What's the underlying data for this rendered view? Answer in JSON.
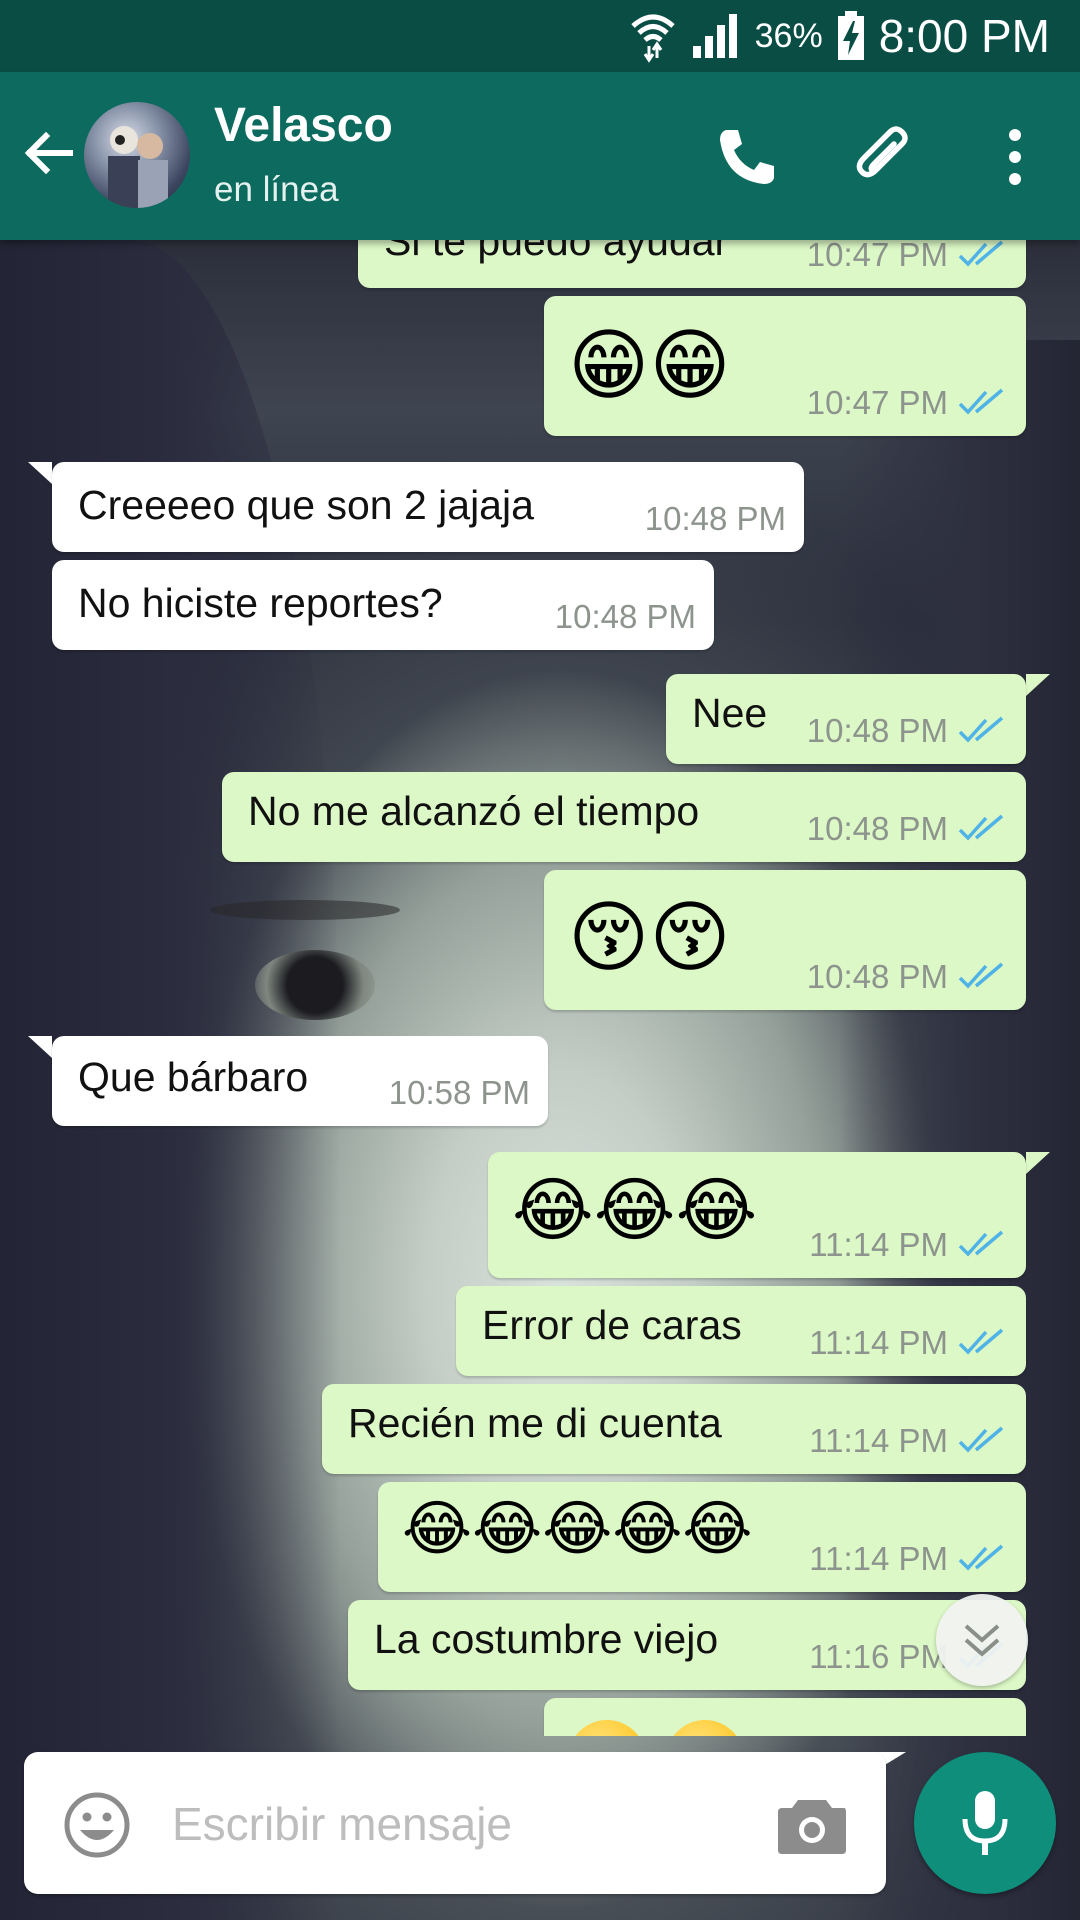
{
  "status_bar": {
    "battery_percent": "36%",
    "time": "8:00 PM",
    "icons": [
      "wifi-icon",
      "signal-icon",
      "battery-charging-icon"
    ]
  },
  "header": {
    "contact_name": "Velasco",
    "contact_status": "en línea",
    "icons": [
      "back-arrow-icon",
      "phone-icon",
      "paperclip-icon",
      "more-vert-icon"
    ],
    "colors": {
      "status_bar": "#094d44",
      "app_bar": "#0c6b5e"
    }
  },
  "messages": [
    {
      "dir": "out",
      "text": "Si te puedo ayudar",
      "time": "10:47 PM"
    },
    {
      "dir": "out",
      "emoji": "😁😁",
      "time": "10:47 PM"
    },
    {
      "dir": "in",
      "text": "Creeeeo que son 2 jajaja",
      "time": "10:48 PM"
    },
    {
      "dir": "in",
      "text": "No hiciste reportes?",
      "time": "10:48 PM"
    },
    {
      "dir": "out",
      "text": "Nee",
      "time": "10:48 PM"
    },
    {
      "dir": "out",
      "text": "No me alcanzó el tiempo",
      "time": "10:48 PM"
    },
    {
      "dir": "out",
      "emoji": "😚😚",
      "time": "10:48 PM"
    },
    {
      "dir": "in",
      "text": "Que bárbaro",
      "time": "10:58 PM"
    },
    {
      "dir": "out",
      "emoji": "😂😂😂",
      "time": "11:14 PM"
    },
    {
      "dir": "out",
      "text": "Error de caras",
      "time": "11:14 PM"
    },
    {
      "dir": "out",
      "text": "Recién me di cuenta",
      "time": "11:14 PM"
    },
    {
      "dir": "out",
      "emoji": "😂😂😂😂😂",
      "time": "11:14 PM"
    },
    {
      "dir": "out",
      "text": "La costumbre viejo",
      "time": "11:16 PM"
    }
  ],
  "colors": {
    "outgoing_bubble": "#dcf8c6",
    "incoming_bubble": "#ffffff",
    "read_ticks": "#4fb3e8",
    "mic_button": "#0f8e7b"
  },
  "input_bar": {
    "placeholder": "Escribir mensaje",
    "icons": [
      "emoji-icon",
      "camera-icon",
      "mic-icon"
    ]
  }
}
